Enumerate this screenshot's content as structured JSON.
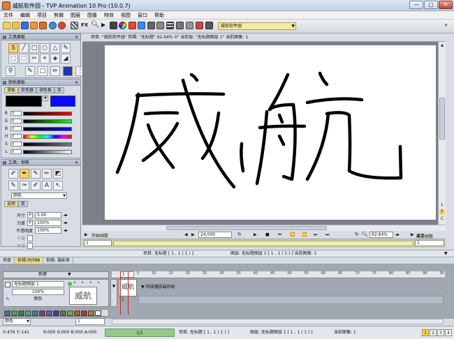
{
  "window": {
    "title": "威航软件园 - TVP Animation 10 Pro (10.0.7)",
    "controls": [
      "—",
      "□",
      "✕"
    ]
  },
  "menu": [
    "文件",
    "编辑",
    "项目",
    "剪辑",
    "图层",
    "图像",
    "特效",
    "视图",
    "窗口",
    "帮助"
  ],
  "toolbar": {
    "fx_label": "FX",
    "project_combo": "威航软件园"
  },
  "tool_panel": {
    "title": "工具面板",
    "tools_row1": [
      "S",
      "╱",
      "□",
      "○",
      "△",
      "✎"
    ],
    "tools_row2": [
      "⬚",
      "⬚",
      "✂",
      "⌖",
      "◈",
      "◢"
    ]
  },
  "color_panel": {
    "title": "颜色面板",
    "tabs": [
      "滑板",
      "拾色器",
      "调色板",
      "库"
    ],
    "active_tab": "滑板",
    "primary_color": "#000000",
    "secondary_color": "#0000ff",
    "sliders": [
      {
        "label": "R",
        "value": "0"
      },
      {
        "label": "G",
        "value": "0"
      },
      {
        "label": "B",
        "value": "0"
      },
      {
        "label": "H",
        "value": "0"
      },
      {
        "label": "S",
        "value": "0"
      },
      {
        "label": "L",
        "value": "0"
      }
    ]
  },
  "brush_panel": {
    "title": "工具：钢笔",
    "color_mode": "颜色",
    "tabs": [
      "选项",
      "库"
    ],
    "active_tab": "选项",
    "size_label": "尺寸",
    "size_value": "5.00",
    "power_label": "力度",
    "power_value": "100%",
    "opacity_label": "不透明度",
    "opacity_value": "100%",
    "dry_label": "干燥",
    "aa_label": "平滑"
  },
  "project_info": "项目: \"威航软件园\"  剪辑: \"无标题\"   62.64%   0°  当前层: \"无标题图层 1\"  当前图像: 1",
  "navbar": {
    "start_frame_label": "开始帧数",
    "start_frame_value": "1",
    "fps": "24.000",
    "zoom": "62.64%",
    "display_label": "显示",
    "end_frame_label": "结束帧数",
    "end_frame_value": "1"
  },
  "mid_status": {
    "left": "项目: 无标题 [ 1 , 1 ( 1 ) ]",
    "right": "图层: 无标题图层 1 [ 1 , 1 ( 1 ) ]  当前图像: 1"
  },
  "timeline_tabs": [
    "项目",
    "剪辑:时间轴",
    "剪辑: 摄影表"
  ],
  "timeline_active_tab": "剪辑:时间轴",
  "timeline": {
    "new_label": "新建",
    "layer_name": "无标题图层 1",
    "opacity": "100%",
    "color_label": "颜色",
    "thumb_text": "威航",
    "hold_label": "持续播放最后帧",
    "frame_number": "1",
    "ruler_marks": [
      "5",
      "10",
      "15",
      "20",
      "25",
      "30",
      "35",
      "40",
      "45",
      "50",
      "55",
      "60",
      "65",
      "70",
      "75",
      "80",
      "85",
      "90",
      "95"
    ],
    "current_frame_box": "1",
    "swatch_colors": [
      "#4a6d9a",
      "#5a9a5a",
      "#3f7f3f",
      "#5a9a9a",
      "#3f7f8f",
      "#7a3f7f",
      "#5f5f9f",
      "#3f3f8f",
      "#4f7f4f",
      "#7f9f4f",
      "#9f5f3f",
      "#9f3f3f",
      "#9f7f3f",
      "#f0f0f0"
    ],
    "bottom_field": "1"
  },
  "status_bar": {
    "coords": "X:476   Y:-141",
    "rgba": "R:000 G:000 B:000 A:000",
    "frame_ratio": "1/1",
    "project": "项目: 无标题 [ 1 , 1 ( 1 ) ]",
    "layer": "图层: 无标题图层 1 [ 1 , 1 ( 1 ) ]",
    "current_image": "当前图像: 1",
    "pages": [
      "1",
      "2",
      "3",
      "4"
    ],
    "active_page": "1"
  },
  "side_flags": [
    "L",
    "F",
    "C"
  ]
}
